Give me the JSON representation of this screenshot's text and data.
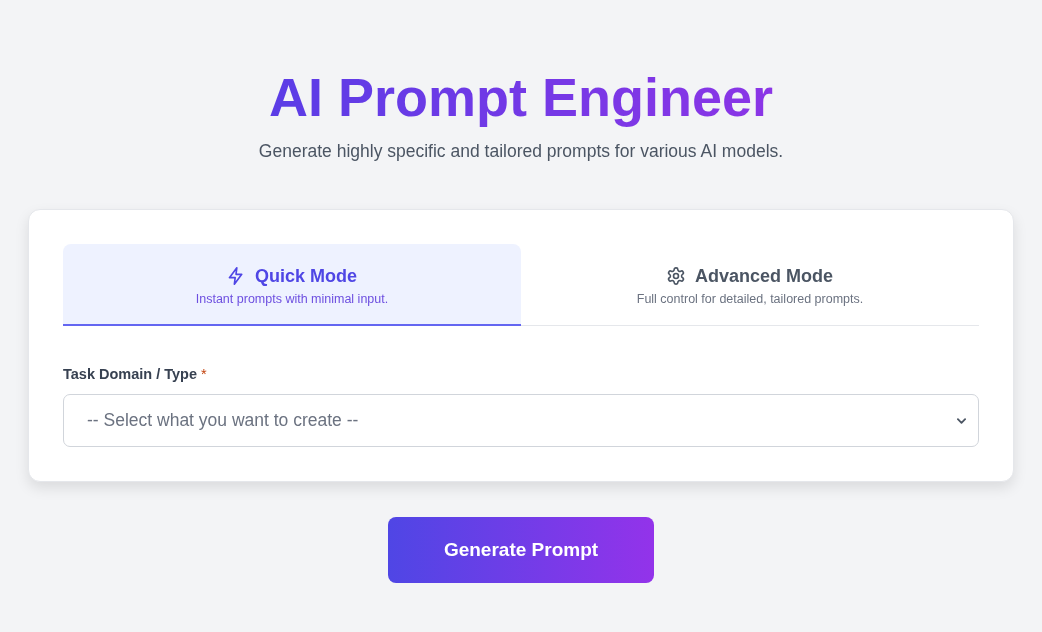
{
  "header": {
    "title": "AI Prompt Engineer",
    "subtitle": "Generate highly specific and tailored prompts for various AI models."
  },
  "tabs": [
    {
      "label": "Quick Mode",
      "description": "Instant prompts with minimal input.",
      "selected": true
    },
    {
      "label": "Advanced Mode",
      "description": "Full control for detailed, tailored prompts.",
      "selected": false
    }
  ],
  "field": {
    "label": "Task Domain / Type",
    "required_mark": "*",
    "placeholder": "-- Select what you want to create --"
  },
  "submit": {
    "label": "Generate Prompt"
  }
}
